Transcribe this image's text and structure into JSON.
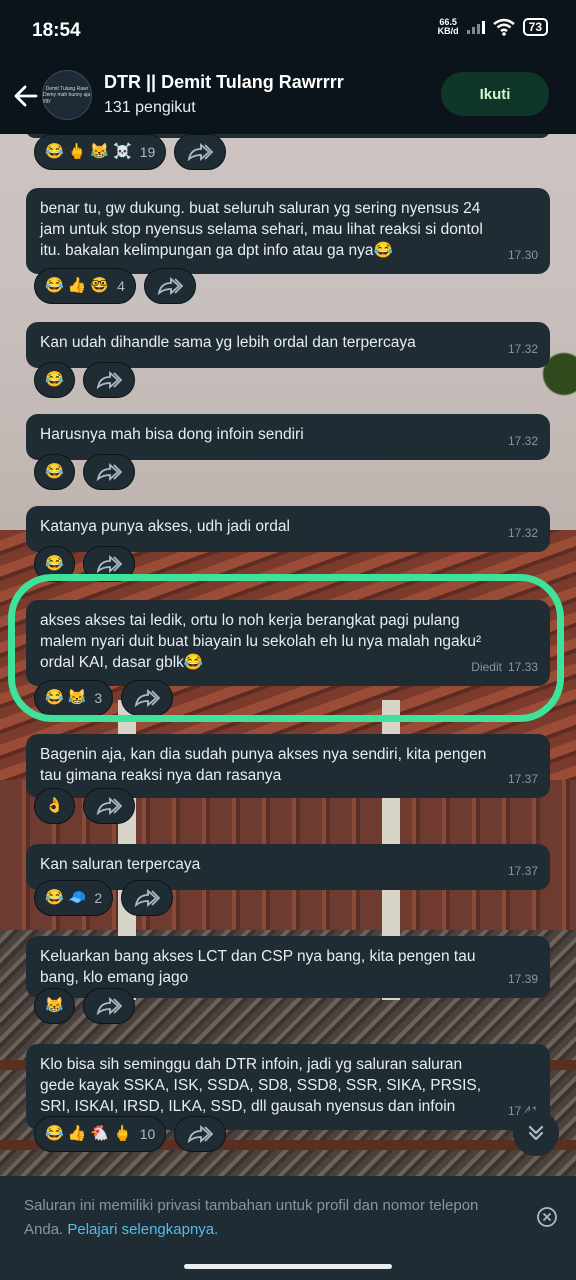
{
  "status": {
    "time": "18:54",
    "net_speed_value": "66.5",
    "net_speed_unit": "KB/d",
    "battery": "73"
  },
  "header": {
    "title": "DTR || Demit Tulang Rawrrrr",
    "followers": "131 pengikut",
    "follow_label": "Ikuti",
    "avatar_line1": "Demit Tulang Rawr",
    "avatar_line2": "Demy mah bunny aja ygy"
  },
  "messages": [
    {
      "text": "",
      "time": "",
      "reactions": [
        "😂",
        "🖕",
        "😹",
        "☠️"
      ],
      "count": "19"
    },
    {
      "text": "benar tu, gw dukung. buat seluruh saluran yg sering nyensus 24 jam untuk stop nyensus selama sehari, mau lihat reaksi si dontol itu. bakalan kelimpungan ga dpt info atau ga nya😂",
      "time": "17.30",
      "reactions": [
        "😂",
        "👍",
        "🤓"
      ],
      "count": "4"
    },
    {
      "text": "Kan udah dihandle sama yg lebih ordal dan terpercaya",
      "time": "17.32",
      "reactions": [
        "😂"
      ],
      "count": ""
    },
    {
      "text": "Harusnya mah bisa dong infoin sendiri",
      "time": "17.32",
      "reactions": [
        "😂"
      ],
      "count": ""
    },
    {
      "text": "Katanya punya akses, udh jadi ordal",
      "time": "17.32",
      "reactions": [
        "😂"
      ],
      "count": ""
    },
    {
      "text": "akses akses tai ledik, ortu lo noh kerja berangkat pagi pulang malem nyari duit buat biayain lu sekolah eh lu nya malah ngaku² ordal KAI, dasar gblk😂",
      "time": "17.33",
      "edited": "Diedit",
      "reactions": [
        "😂",
        "😹"
      ],
      "count": "3"
    },
    {
      "text": "Bagenin aja, kan dia sudah punya akses nya sendiri, kita pengen tau gimana reaksi nya dan rasanya",
      "time": "17.37",
      "reactions": [
        "👌"
      ],
      "count": ""
    },
    {
      "text": "Kan saluran terpercaya",
      "time": "17.37",
      "reactions": [
        "😂",
        "🧢"
      ],
      "count": "2"
    },
    {
      "text": "Keluarkan bang akses LCT dan CSP nya bang, kita pengen tau bang, klo emang jago",
      "time": "17.39",
      "reactions": [
        "😹"
      ],
      "count": ""
    },
    {
      "text": "Klo bisa sih seminggu dah DTR infoin, jadi yg saluran saluran gede kayak SSKA, ISK, SSDA, SD8, SSD8, SSR, SIKA, PRSIS, SRI, ISKAI, IRSD, ILKA, SSD, dll gausah nyensus dan infoin",
      "time": "17.41",
      "reactions": [
        "😂",
        "👍",
        "🐔",
        "🖕"
      ],
      "count": "10"
    }
  ],
  "footer": {
    "text": "Saluran ini memiliki privasi tambahan untuk profil dan nomor telepon Anda.",
    "link": "Pelajari selengkapnya."
  },
  "colors": {
    "header_bg": "#0b141a",
    "bubble_bg": "#1f2c34",
    "follow_button_bg": "#103629",
    "highlight": "#3de39a",
    "link": "#53bdeb"
  }
}
